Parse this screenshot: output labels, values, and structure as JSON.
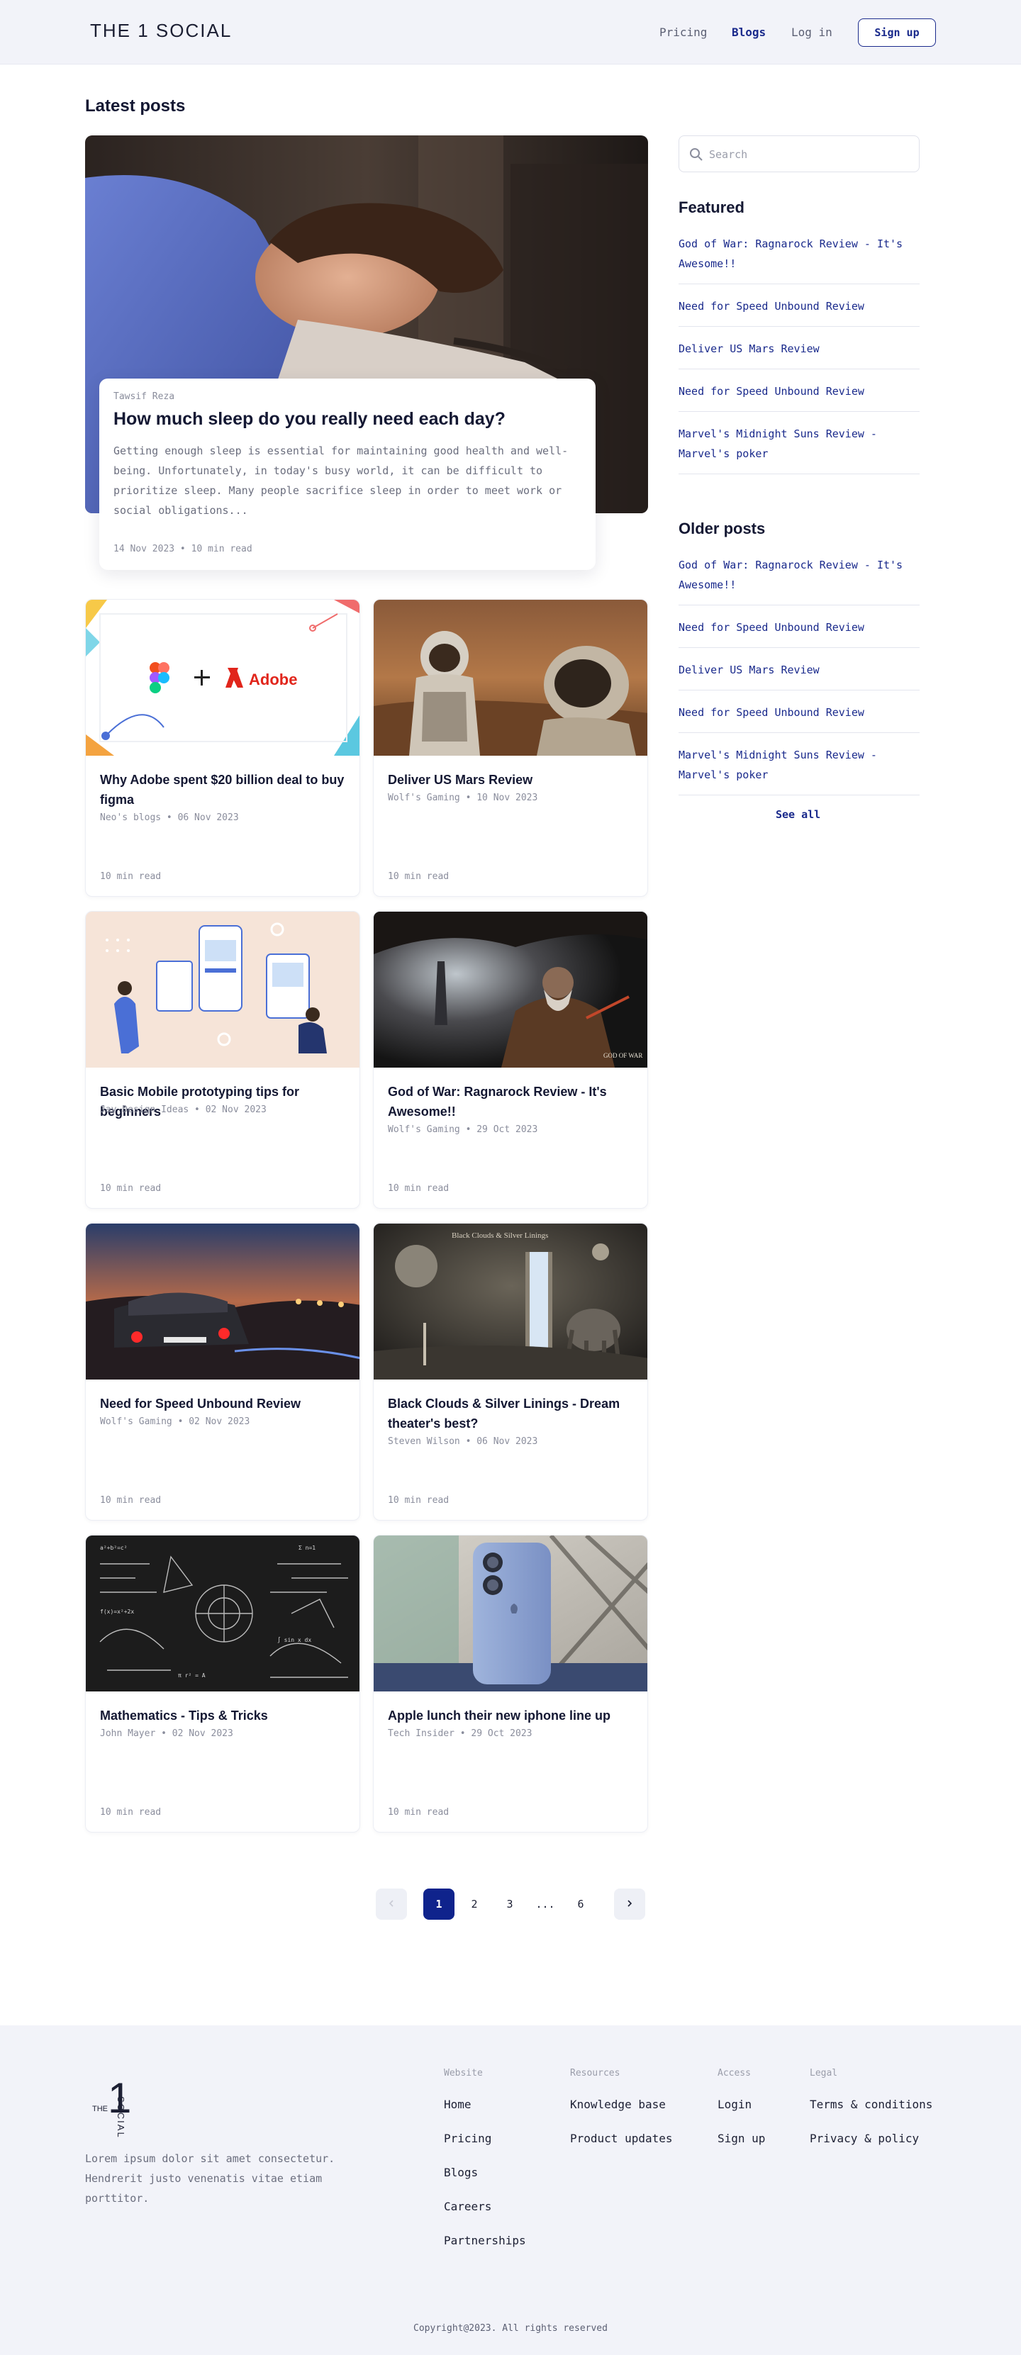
{
  "header": {
    "logo": "THE 1 SOCIAL",
    "nav": [
      "Pricing",
      "Blogs",
      "Log in"
    ],
    "signup": "Sign up"
  },
  "main": {
    "section_title": "Latest posts",
    "hero": {
      "author": "Tawsif Reza",
      "title": "How much sleep do you really need each day?",
      "excerpt": "Getting enough sleep is essential for maintaining good health and well-being. Unfortunately, in today's busy world, it can be difficult to prioritize sleep. Many people sacrifice sleep in order to meet work or social obligations...",
      "meta": "14 Nov 2023 • 10 min read"
    },
    "posts": [
      {
        "title": "Why Adobe spent $20 billion deal to buy figma",
        "meta": "Neo's blogs • 06 Nov 2023",
        "read": "10 min read",
        "thumb": "adobe-figma"
      },
      {
        "title": "Deliver US Mars Review",
        "meta": "Wolf's Gaming • 10 Nov 2023",
        "read": "10 min read",
        "thumb": "mars-astronaut"
      },
      {
        "title": "Basic Mobile prototyping tips for beginners",
        "meta": "Jay Design Ideas • 02 Nov 2023",
        "read": "10 min read",
        "thumb": "mobile-prototype"
      },
      {
        "title": "God of War: Ragnarock Review - It's Awesome!!",
        "meta": "Wolf's Gaming • 29 Oct 2023",
        "read": "10 min read",
        "thumb": "god-of-war"
      },
      {
        "title": "Need for Speed Unbound Review",
        "meta": "Wolf's Gaming • 02 Nov 2023",
        "read": "10 min read",
        "thumb": "nfs-car"
      },
      {
        "title": "Black Clouds & Silver Linings - Dream theater's best?",
        "meta": "Steven Wilson • 06 Nov 2023",
        "read": "10 min read",
        "thumb": "dream-theater"
      },
      {
        "title": "Mathematics - Tips & Tricks",
        "meta": "John Mayer • 02 Nov 2023",
        "read": "10 min read",
        "thumb": "chalkboard"
      },
      {
        "title": "Apple lunch their new iphone line up",
        "meta": "Tech Insider • 29 Oct 2023",
        "read": "10 min read",
        "thumb": "iphone"
      }
    ],
    "god_of_war_watermark": "GOD OF WAR",
    "dream_theater_caption": "Black Clouds & Silver Linings"
  },
  "sidebar": {
    "search_placeholder": "Search",
    "featured_title": "Featured",
    "featured": [
      "God of War: Ragnarock Review - It's Awesome!!",
      "Need for Speed Unbound Review",
      "Deliver US Mars Review",
      "Need for Speed Unbound Review",
      "Marvel's Midnight Suns Review - Marvel's poker"
    ],
    "older_title": "Older posts",
    "older": [
      "God of War: Ragnarock Review - It's Awesome!!",
      "Need for Speed Unbound Review",
      "Deliver US Mars Review",
      "Need for Speed Unbound Review",
      "Marvel's Midnight Suns Review - Marvel's poker"
    ],
    "see_all": "See all"
  },
  "pagination": {
    "pages": [
      "1",
      "2",
      "3",
      "...",
      "6"
    ],
    "current": "1"
  },
  "footer": {
    "logo_small": "THE",
    "logo_big": "1",
    "logo_vertical": "SOCIAL",
    "description": "Lorem ipsum dolor sit amet consectetur. Hendrerit justo venenatis vitae etiam porttitor.",
    "columns": [
      {
        "heading": "Website",
        "links": [
          "Home",
          "Pricing",
          "Blogs",
          "Careers",
          "Partnerships"
        ]
      },
      {
        "heading": "Resources",
        "links": [
          "Knowledge base",
          "Product updates"
        ]
      },
      {
        "heading": "Access",
        "links": [
          "Login",
          "Sign up"
        ]
      },
      {
        "heading": "Legal",
        "links": [
          "Terms & conditions",
          "Privacy & policy"
        ]
      }
    ],
    "copyright": "Copyright@2023. All rights reserved"
  },
  "colors": {
    "accent": "#1a2a8c",
    "header_bg": "#f2f3f9",
    "current_page": "#0f238c"
  }
}
